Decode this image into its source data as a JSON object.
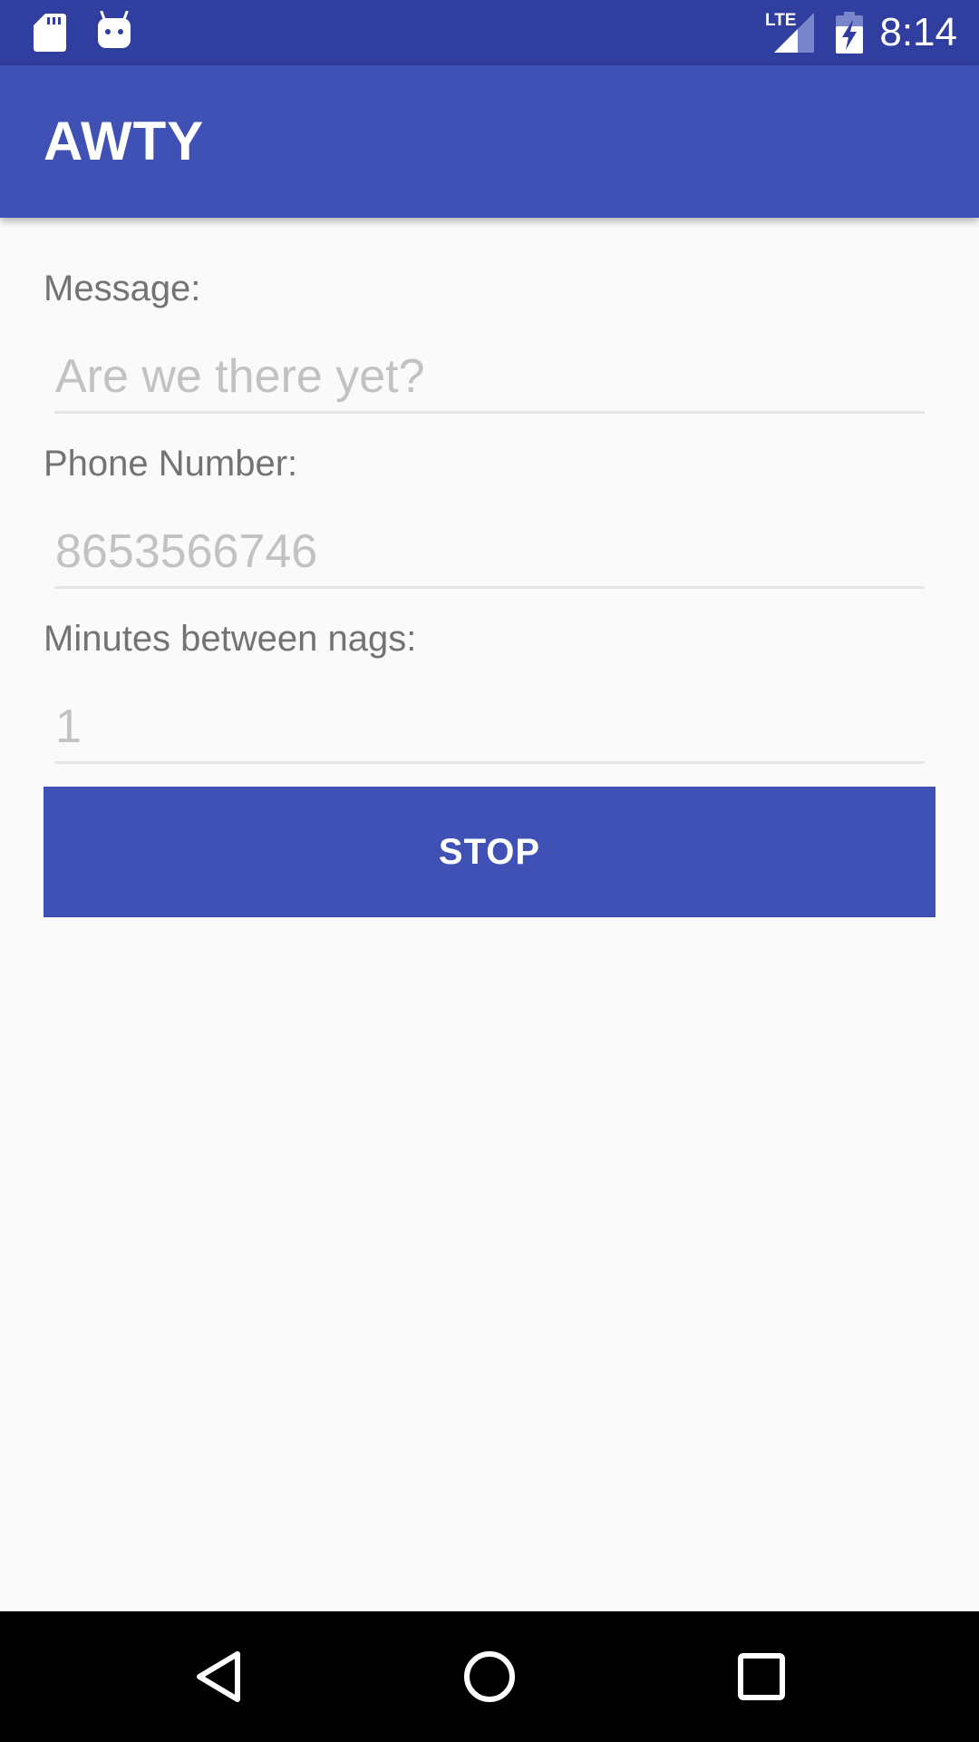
{
  "status_bar": {
    "time": "8:14",
    "network": "LTE",
    "icons": [
      "sd-card-icon",
      "android-debug-icon",
      "lte-signal-icon",
      "battery-charging-icon"
    ]
  },
  "app_bar": {
    "title": "AWTY"
  },
  "form": {
    "message": {
      "label": "Message:",
      "placeholder": "Are we there yet?"
    },
    "phone": {
      "label": "Phone Number:",
      "placeholder": "8653566746"
    },
    "minutes": {
      "label": "Minutes between nags:",
      "placeholder": "1"
    },
    "button_label": "STOP"
  },
  "nav_bar": {
    "icons": [
      "back-icon",
      "home-icon",
      "recents-icon"
    ]
  },
  "colors": {
    "primary": "#3f51b5",
    "primary_dark": "#303f9f",
    "background": "#fafafa",
    "label_text": "#737373",
    "hint_text": "#c2c2c2"
  }
}
